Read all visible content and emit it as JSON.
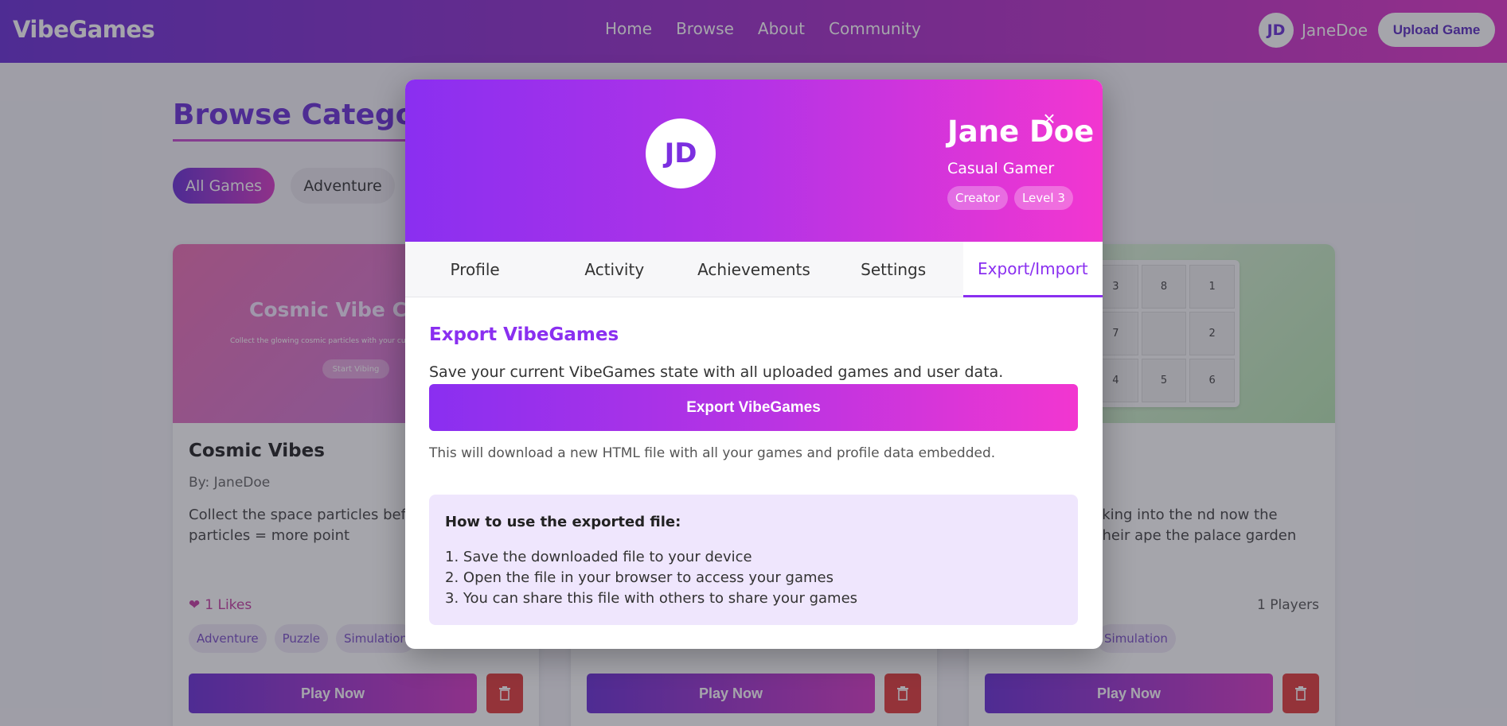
{
  "header": {
    "logo": "VibeGames",
    "nav": [
      "Home",
      "Browse",
      "About",
      "Community"
    ],
    "user_initials": "JD",
    "username": "JaneDoe",
    "upload_label": "Upload Game"
  },
  "page": {
    "title": "Browse Categories",
    "filters": [
      "All Games",
      "Adventure"
    ]
  },
  "cards": [
    {
      "thumb_title": "Cosmic Vibe Col",
      "thumb_sub": "Collect the glowing cosmic particles with your cursor. Bigge",
      "thumb_btn": "Start Vibing",
      "title": "Cosmic Vibes",
      "by": "By: JaneDoe",
      "desc": "Collect the space particles before out. More particles = more point",
      "likes": "1 Likes",
      "tags": [
        "Adventure",
        "Puzzle",
        "Simulation"
      ],
      "play": "Play Now"
    },
    {
      "title": "",
      "play": "Play Now"
    },
    {
      "grid": [
        "3",
        "8",
        "1",
        "7",
        "",
        "2",
        "4",
        "5",
        "6"
      ],
      "desc": "arm while sneaking into the nd now the guards are on their ape the palace garden maze in",
      "players": "1 Players",
      "tags": [
        "Simulation"
      ],
      "play": "Play Now"
    }
  ],
  "modal": {
    "initials": "JD",
    "name": "Jane Doe",
    "role": "Casual Gamer",
    "badges": [
      "Creator",
      "Level 3"
    ],
    "close": "×",
    "tabs": [
      "Profile",
      "Activity",
      "Achievements",
      "Settings",
      "Export/Import"
    ],
    "active_tab": "Export/Import",
    "section_title": "Export VibeGames",
    "section_desc": "Save your current VibeGames state with all uploaded games and user data.",
    "export_button": "Export VibeGames",
    "export_note": "This will download a new HTML file with all your games and profile data embedded.",
    "howto_title": "How to use the exported file:",
    "howto_steps": [
      "1. Save the downloaded file to your device",
      "2. Open the file in your browser to access your games",
      "3. You can share this file with others to share your games"
    ]
  },
  "colors": {
    "brand_purple": "#8a2ff0",
    "brand_pink": "#f236d0",
    "delete_red": "#e23b3b"
  }
}
